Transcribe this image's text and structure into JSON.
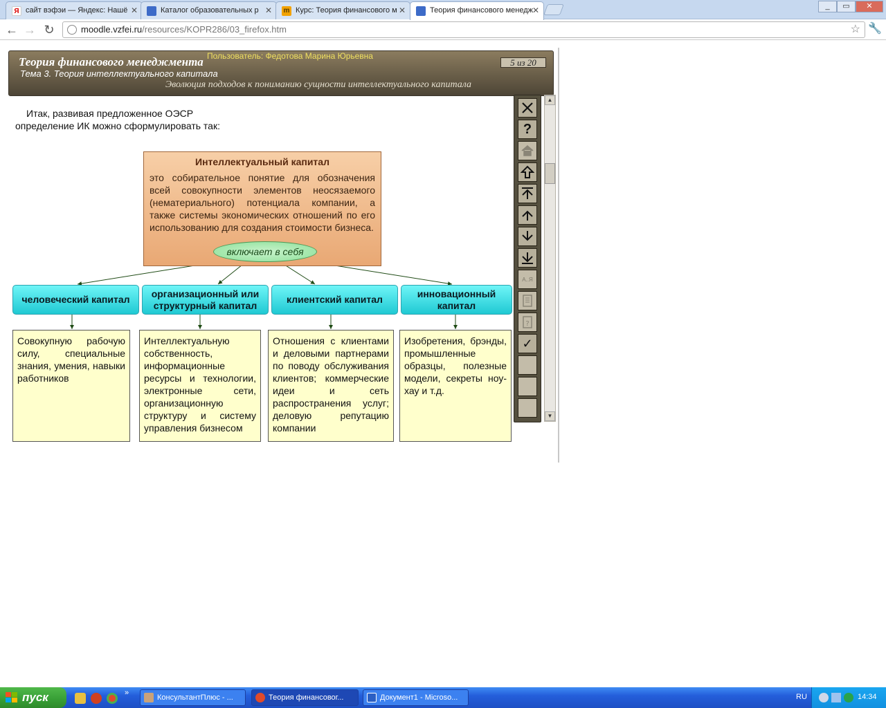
{
  "browser": {
    "tabs": [
      {
        "label": "сайт вэфэи — Яндекс: Нашё",
        "icon": "yandex-icon",
        "active": false
      },
      {
        "label": "Каталог образовательных р",
        "icon": "page-icon",
        "active": false
      },
      {
        "label": "Курс: Теория финансового м",
        "icon": "moodle-icon",
        "active": false
      },
      {
        "label": "Теория финансового менедж",
        "icon": "page-icon",
        "active": true
      }
    ],
    "address": {
      "host": "moodle.vzfei.ru",
      "path": "/resources/KOPR286/03_firefox.htm"
    }
  },
  "banner": {
    "title": "Теория финансового менеджмента",
    "user": "Пользователь: Федотова Марина Юрьевна",
    "topic": "Тема 3. Теория интеллектуального капитала",
    "subtitle": "Эволюция подходов к пониманию сущности интеллектуального капитала",
    "counter": "5 из 20"
  },
  "content": {
    "intro_line1": "Итак,  развивая предложенное ОЭСР",
    "intro_line2": "определение ИК можно сформулировать так:",
    "definition": {
      "title": "Интеллектуальный капитал",
      "text": "это собирательное понятие для обозначения всей совокупности элементов неосязаемого (нематериального)  потенциала компании, а также системы экономических отношений по его использованию для создания стоимости бизнеса.",
      "includes": "включает в себя"
    },
    "categories": [
      {
        "title": "человеческий капитал",
        "desc": "Совокупную рабочую силу, специальные знания, умения, навыки работников"
      },
      {
        "title": "организационный или структурный капитал",
        "desc": "Интеллектуальную собственность, информационные ресурсы и технологии, электронные сети, организационную структуру и систему управления бизнесом"
      },
      {
        "title": "клиентский капитал",
        "desc": "Отношения с клиентами и деловыми партнерами по поводу обслуживания клиентов; коммерческие идеи и сеть распространения услуг; деловую репутацию компании"
      },
      {
        "title": "инновационный капитал",
        "desc": "Изобретения, брэнды, промышленные образцы, полезные модели, секреты ноу-хау и т.д."
      }
    ]
  },
  "sidebar": {
    "buttons": [
      "close-icon",
      "help-icon",
      "home-icon",
      "up-arrow-icon",
      "first-page-icon",
      "prev-page-icon",
      "next-page-icon",
      "last-page-icon",
      "glossary-icon",
      "notes-icon",
      "test-icon",
      "check-icon",
      "empty",
      "empty",
      "empty"
    ],
    "help_glyph": "?",
    "check_glyph": "✓",
    "glossary_glyph": "А..Я"
  },
  "taskbar": {
    "start_label": "пуск",
    "tasks": [
      {
        "label": "КонсультантПлюс - ...",
        "active": false
      },
      {
        "label": "Теория финансовог...",
        "active": true
      },
      {
        "label": "Документ1 - Microso...",
        "active": false
      }
    ],
    "lang": "RU",
    "clock": "14:34"
  }
}
